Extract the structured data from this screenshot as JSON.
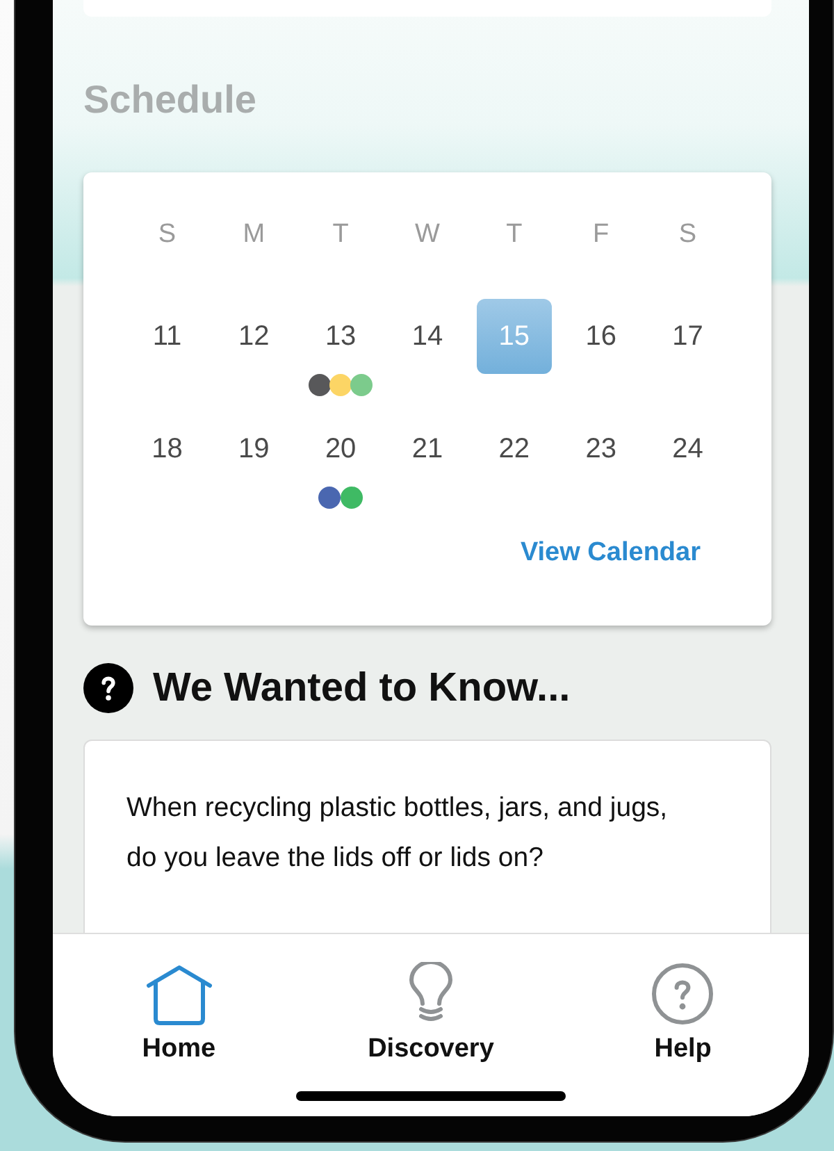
{
  "schedule": {
    "title": "Schedule",
    "weekdays": [
      "S",
      "M",
      "T",
      "W",
      "T",
      "F",
      "S"
    ],
    "weeks": [
      {
        "days": [
          {
            "label": "11",
            "selected": false
          },
          {
            "label": "12",
            "selected": false
          },
          {
            "label": "13",
            "selected": false,
            "dots": [
              {
                "color": "#58585a"
              },
              {
                "color": "#fcd565"
              },
              {
                "color": "#7ccb8c"
              }
            ]
          },
          {
            "label": "14",
            "selected": false
          },
          {
            "label": "15",
            "selected": true
          },
          {
            "label": "16",
            "selected": false
          },
          {
            "label": "17",
            "selected": false
          }
        ]
      },
      {
        "days": [
          {
            "label": "18",
            "selected": false
          },
          {
            "label": "19",
            "selected": false
          },
          {
            "label": "20",
            "selected": false,
            "dots": [
              {
                "color": "#4a67b0"
              },
              {
                "color": "#3fba64"
              }
            ]
          },
          {
            "label": "21",
            "selected": false
          },
          {
            "label": "22",
            "selected": false
          },
          {
            "label": "23",
            "selected": false
          },
          {
            "label": "24",
            "selected": false
          }
        ]
      }
    ],
    "link": "View Calendar"
  },
  "question": {
    "title": "We Wanted to Know...",
    "text": "When recycling plastic bottles, jars, and jugs, do you leave the lids off or lids on?"
  },
  "nav": {
    "items": [
      {
        "kind": "home",
        "label": "Home",
        "selected": true
      },
      {
        "kind": "idea",
        "label": "Discovery",
        "selected": false
      },
      {
        "kind": "help",
        "label": "Help",
        "selected": false
      }
    ]
  }
}
